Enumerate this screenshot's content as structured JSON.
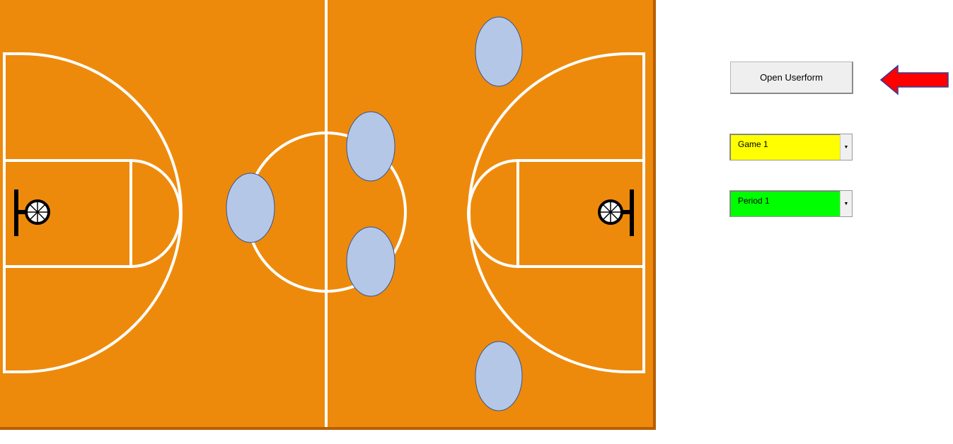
{
  "court": {
    "floor_color": "#ee8a0b",
    "border_color": "#b85e00",
    "line_color": "#ffffff",
    "player_color": "#b4c7e7",
    "player_outline": "#2f5597"
  },
  "controls": {
    "open_button_label": "Open Userform",
    "game_select": {
      "value": "Game 1",
      "color": "#ffff00"
    },
    "period_select": {
      "value": "Period 1",
      "color": "#00ff00"
    },
    "pointer_arrow_color": "#ff0000"
  }
}
